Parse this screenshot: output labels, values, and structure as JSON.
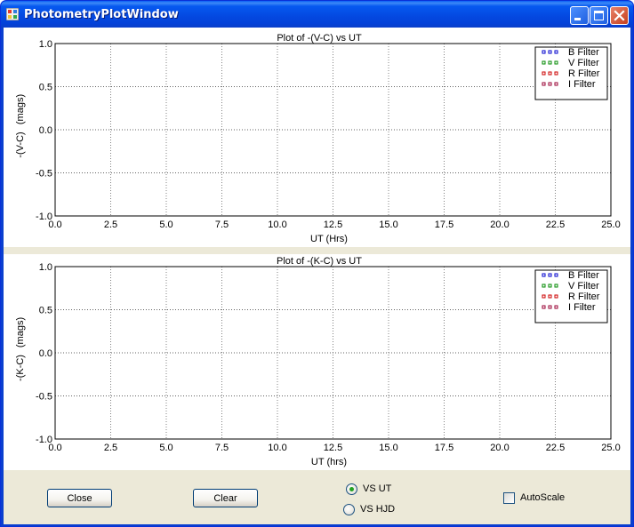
{
  "window": {
    "title": "PhotometryPlotWindow"
  },
  "plots": [
    {
      "title": "Plot of -(V-C) vs UT",
      "ylabel_left": "-(V-C)",
      "ylabel_right": "(mags)",
      "xlabel": "UT (Hrs)",
      "legend": [
        {
          "label": "B Filter",
          "color": "#0000cc"
        },
        {
          "label": "V Filter",
          "color": "#008800"
        },
        {
          "label": "R Filter",
          "color": "#cc0000"
        },
        {
          "label": "I Filter",
          "color": "#990033"
        }
      ]
    },
    {
      "title": "Plot of -(K-C) vs UT",
      "ylabel_left": "-(K-C)",
      "ylabel_right": "(mags)",
      "xlabel": "UT (hrs)",
      "legend": [
        {
          "label": "B Filter",
          "color": "#0000cc"
        },
        {
          "label": "V Filter",
          "color": "#008800"
        },
        {
          "label": "R Filter",
          "color": "#cc0000"
        },
        {
          "label": "I Filter",
          "color": "#990033"
        }
      ]
    }
  ],
  "chart_data": [
    {
      "type": "scatter",
      "title": "Plot of -(V-C) vs UT",
      "xlabel": "UT (Hrs)",
      "ylabel": "-(V-C) (mags)",
      "xlim": [
        0.0,
        25.0
      ],
      "ylim": [
        -1.0,
        1.0
      ],
      "x_ticks": [
        "0.0",
        "2.5",
        "5.0",
        "7.5",
        "10.0",
        "12.5",
        "15.0",
        "17.5",
        "20.0",
        "22.5",
        "25.0"
      ],
      "y_ticks": [
        "1.0",
        "0.5",
        "0.0",
        "-0.5",
        "-1.0"
      ],
      "grid": true,
      "legend_position": "top-right",
      "series": [
        {
          "name": "B Filter",
          "values": []
        },
        {
          "name": "V Filter",
          "values": []
        },
        {
          "name": "R Filter",
          "values": []
        },
        {
          "name": "I Filter",
          "values": []
        }
      ]
    },
    {
      "type": "scatter",
      "title": "Plot of -(K-C) vs UT",
      "xlabel": "UT (hrs)",
      "ylabel": "-(K-C) (mags)",
      "xlim": [
        0.0,
        25.0
      ],
      "ylim": [
        -1.0,
        1.0
      ],
      "x_ticks": [
        "0.0",
        "2.5",
        "5.0",
        "7.5",
        "10.0",
        "12.5",
        "15.0",
        "17.5",
        "20.0",
        "22.5",
        "25.0"
      ],
      "y_ticks": [
        "1.0",
        "0.5",
        "0.0",
        "-0.5",
        "-1.0"
      ],
      "grid": true,
      "legend_position": "top-right",
      "series": [
        {
          "name": "B Filter",
          "values": []
        },
        {
          "name": "V Filter",
          "values": []
        },
        {
          "name": "R Filter",
          "values": []
        },
        {
          "name": "I Filter",
          "values": []
        }
      ]
    }
  ],
  "controls": {
    "close_label": "Close",
    "clear_label": "Clear",
    "radio_vs_ut_label": "VS UT",
    "radio_vs_hjd_label": "VS HJD",
    "radio_selected": "VS UT",
    "autoscale_label": "AutoScale",
    "autoscale_checked": false
  }
}
